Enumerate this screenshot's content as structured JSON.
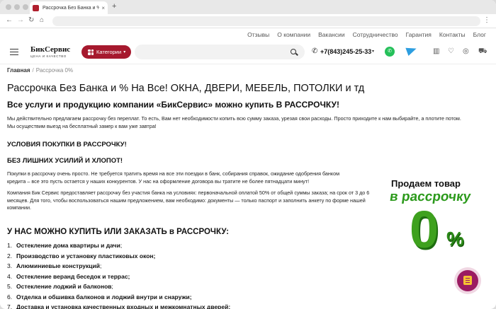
{
  "browser": {
    "tab_title": "Рассрочка Без Банка и % н",
    "tab_close": "×",
    "new_tab": "+",
    "back": "←",
    "forward": "→",
    "reload": "↻",
    "home": "⌂",
    "menu": "⋮"
  },
  "toplinks": [
    "Отзывы",
    "О компании",
    "Вакансии",
    "Сотрудничество",
    "Гарантия",
    "Контакты",
    "Блог"
  ],
  "header": {
    "logo_name": "БикСервис",
    "logo_tagline": "ЦЕНА И КАЧЕСТВО",
    "catalog_label": "Категории",
    "search_placeholder": "",
    "phone": "+7(843)245-25-33",
    "accent_color": "#a6192e"
  },
  "breadcrumb": {
    "home": "Главная",
    "separator": "/",
    "current": "Рассрочка 0%"
  },
  "content": {
    "title": "Рассрочка Без Банка и % На Все! ОКНА, ДВЕРИ, МЕБЕЛЬ, ПОТОЛКИ и тд",
    "subtitle": "Все услуги и продукцию компании «БикСервис» можно купить В РАССРОЧКУ!",
    "intro_1": "Мы действительно предлагаем рассрочку без переплат. То есть, Вам нет необходимости копить всю сумму заказа, урезая свои расходы. Просто приходите к нам выбирайте, а плотите потом.",
    "intro_2": "Мы осуществим выезд на бесплатный замер к вам уже завтра!",
    "conditions_title": "УСЛОВИЯ ПОКУПКИ В РАССРОЧКУ!",
    "no_effort_title": "БЕЗ ЛИШНИХ УСИЛИЙ И ХЛОПОТ!",
    "para_1": "Покупки в рассрочку очень просто. Не требуется тратить время на все эти поездки в банк, собирания справок, ожидание одобрения банком кредита – все это пусть остается у наших конкурентов. У нас на оформление договора вы тратите не более пятнадцати минут!",
    "para_2": "Компания Бик Сервис предоставляет рассрочку без участия банка на условиях: первоначальной оплатой 50% от общей суммы заказа; на срок от 3 до 6 месяцев. Для того, чтобы воспользоваться нашим предложением, вам необходимо: документы — только паспорт и заполнить анкету по форме нашей компании.",
    "list_title": "У НАС МОЖНО КУПИТЬ ИЛИ ЗАКАЗАТЬ в РАССРОЧКУ:",
    "list": [
      {
        "n": "1.",
        "text": "Остекление дома квартиры и дачи",
        "tail": ";"
      },
      {
        "n": "2.",
        "text": "Производство и установку пластиковых окон;",
        "tail": ""
      },
      {
        "n": "3.",
        "text": "Алюминиевые конструкций",
        "tail": ";"
      },
      {
        "n": "4.",
        "text": "Остекление веранд беседок и террас;",
        "tail": ""
      },
      {
        "n": "5.",
        "text": "Остекление лоджий и балконов",
        "tail": ";"
      },
      {
        "n": "6.",
        "text": "Отделка и обшивка балконов и лоджий внутри и снаружи;",
        "tail": ""
      },
      {
        "n": "7.",
        "text": "Доставка и установка качественных входных и межкомнатных дверей;",
        "tail": ""
      }
    ]
  },
  "promo": {
    "line_1": "Продаем товар",
    "line_2": "в рассрочку",
    "zero": "0",
    "percent": "%",
    "color": "#3ea11e"
  }
}
